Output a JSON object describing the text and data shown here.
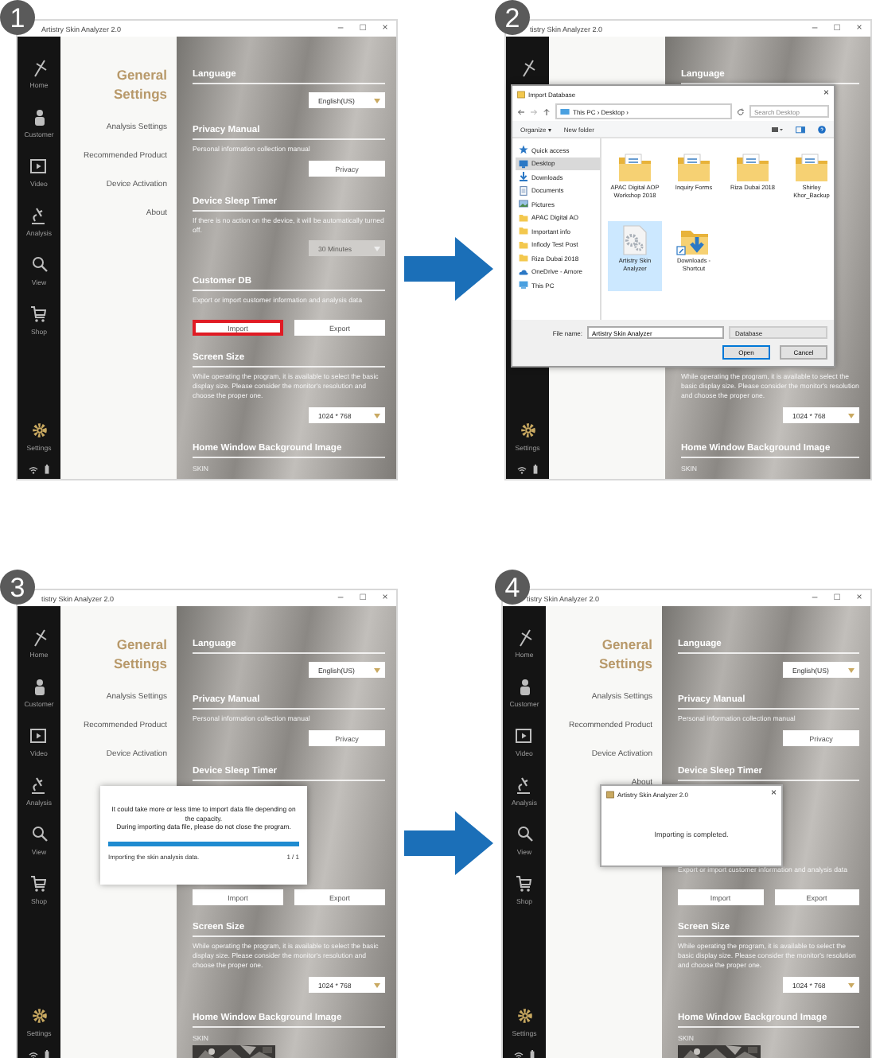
{
  "steps": [
    {
      "number": "1",
      "window": {
        "title": "Artistry Skin Analyzer 2.0",
        "controls": [
          "–",
          "□",
          "×"
        ],
        "nav": [
          {
            "kind": "home",
            "label": "Home"
          },
          {
            "kind": "customer",
            "label": "Customer"
          },
          {
            "kind": "video",
            "label": "Video"
          },
          {
            "kind": "analysis",
            "label": "Analysis"
          },
          {
            "kind": "view",
            "label": "View"
          },
          {
            "kind": "shop",
            "label": "Shop"
          },
          {
            "kind": "settings",
            "label": "Settings"
          }
        ],
        "menu": {
          "title": "General Settings",
          "items": [
            "Analysis Settings",
            "Recommended Product",
            "Device Activation",
            "About"
          ]
        },
        "sections": [
          {
            "kind": "language",
            "heading": "Language",
            "dropdown": {
              "value": "English(US)",
              "disabled": false
            }
          },
          {
            "kind": "privacy",
            "heading": "Privacy Manual",
            "description": "Personal information collection manual",
            "buttons": [
              {
                "label": "Privacy",
                "highlighted": false
              }
            ]
          },
          {
            "kind": "sleep",
            "heading": "Device Sleep Timer",
            "description": "If there is no action on the device, it will be automatically turned off.",
            "dropdown": {
              "value": "30 Minutes",
              "disabled": true
            }
          },
          {
            "kind": "customer_db",
            "heading": "Customer DB",
            "description": "Export or import customer information and analysis data",
            "buttons": [
              {
                "label": "Import",
                "highlighted": true
              },
              {
                "label": "Export",
                "highlighted": false
              }
            ]
          },
          {
            "kind": "screen_size",
            "heading": "Screen Size",
            "description": "While operating the program, it is available to select the basic display size. Please consider the monitor's resolution and choose the proper one.",
            "dropdown": {
              "value": "1024 * 768",
              "disabled": false
            }
          },
          {
            "kind": "background",
            "heading": "Home Window Background Image",
            "caption": "SKIN"
          }
        ]
      }
    },
    {
      "number": "2",
      "window": {
        "title": "tistry Skin Analyzer 2.0",
        "controls": [
          "–",
          "□",
          "×"
        ],
        "nav": [
          {
            "kind": "home"
          },
          {
            "kind": "settings",
            "label": "Settings"
          }
        ],
        "sections": [
          {
            "kind": "language",
            "heading": "Language"
          },
          {
            "kind": "screen_size",
            "description": "While operating the program, it is available to select the basic display size. Please consider the monitor's resolution and choose the proper one.",
            "dropdown": {
              "value": "1024 * 768",
              "disabled": false
            }
          },
          {
            "kind": "background",
            "heading": "Home Window Background Image",
            "caption": "SKIN"
          }
        ]
      },
      "overlay": {
        "kind": "file_dialog",
        "title": "Import Database",
        "close": "×",
        "path": "This PC  ›  Desktop  ›",
        "search": {
          "placeholder": "Search Desktop"
        },
        "toolbar": [
          "Organize ▾",
          "New folder"
        ],
        "tree": [
          {
            "kind": "star",
            "label": "Quick access",
            "selected": false
          },
          {
            "kind": "desktop",
            "label": "Desktop",
            "selected": true
          },
          {
            "kind": "download",
            "label": "Downloads",
            "selected": false
          },
          {
            "kind": "documents",
            "label": "Documents",
            "selected": false
          },
          {
            "kind": "pictures",
            "label": "Pictures",
            "selected": false
          },
          {
            "kind": "folder",
            "label": "APAC Digital AO",
            "selected": false
          },
          {
            "kind": "folder",
            "label": "Important info",
            "selected": false
          },
          {
            "kind": "folder",
            "label": "Infiody Test Post",
            "selected": false
          },
          {
            "kind": "folder",
            "label": "Riza Dubai 2018",
            "selected": false
          },
          {
            "kind": "cloud",
            "label": "OneDrive - Amore",
            "selected": false
          },
          {
            "kind": "pc",
            "label": "This PC",
            "selected": false
          }
        ],
        "files": [
          {
            "kind": "folder",
            "name": "APAC Digital AOP Workshop 2018",
            "selected": false
          },
          {
            "kind": "folder",
            "name": "Inquiry Forms",
            "selected": false
          },
          {
            "kind": "folder",
            "name": "Riza Dubai 2018",
            "selected": false
          },
          {
            "kind": "folder",
            "name": "Shirley Khor_Backup",
            "selected": false
          },
          {
            "kind": "file",
            "name": "Artistry Skin Analyzer",
            "selected": true
          },
          {
            "kind": "shortcut",
            "name": "Downloads - Shortcut",
            "selected": false
          }
        ],
        "file_name_label": "File name:",
        "file_name": "Artistry Skin Analyzer",
        "file_type": "Database",
        "buttons": [
          "Open",
          "Cancel"
        ]
      }
    },
    {
      "number": "3",
      "window": {
        "title": "tistry Skin Analyzer 2.0",
        "controls": [
          "–",
          "□",
          "×"
        ],
        "nav": [
          {
            "kind": "home",
            "label": "Home"
          },
          {
            "kind": "customer",
            "label": "Customer"
          },
          {
            "kind": "video",
            "label": "Video"
          },
          {
            "kind": "analysis",
            "label": "Analysis"
          },
          {
            "kind": "view",
            "label": "View"
          },
          {
            "kind": "shop",
            "label": "Shop"
          },
          {
            "kind": "settings",
            "label": "Settings"
          }
        ],
        "menu": {
          "title": "General Settings",
          "items": [
            "Analysis Settings",
            "Recommended Product",
            "Device Activation"
          ]
        },
        "sections": [
          {
            "kind": "language",
            "heading": "Language",
            "dropdown": {
              "value": "English(US)",
              "disabled": false
            }
          },
          {
            "kind": "privacy",
            "heading": "Privacy Manual",
            "description": "Personal information collection manual",
            "buttons": [
              {
                "label": "Privacy",
                "highlighted": false
              }
            ]
          },
          {
            "kind": "sleep",
            "heading": "Device Sleep Timer"
          },
          {
            "kind": "customer_db",
            "buttons": [
              {
                "label": "Import",
                "highlighted": false
              },
              {
                "label": "Export",
                "highlighted": false
              }
            ]
          },
          {
            "kind": "screen_size",
            "heading": "Screen Size",
            "description": "While operating the program, it is available to select the basic display size. Please consider the monitor's resolution and choose the proper one.",
            "dropdown": {
              "value": "1024 * 768",
              "disabled": false
            }
          },
          {
            "kind": "background",
            "heading": "Home Window Background Image",
            "caption": "SKIN"
          }
        ]
      },
      "overlay": {
        "kind": "progress",
        "lines": [
          "It could take more or less time to import data file depending on the capacity.",
          "During importing data file, please do not close the program."
        ],
        "level": 1,
        "status": "Importing the skin analysis data.",
        "count": "1 / 1"
      }
    },
    {
      "number": "4",
      "window": {
        "title": "tistry Skin Analyzer 2.0",
        "controls": [
          "–",
          "□",
          "×"
        ],
        "nav": [
          {
            "kind": "home",
            "label": "Home"
          },
          {
            "kind": "customer",
            "label": "Customer"
          },
          {
            "kind": "video",
            "label": "Video"
          },
          {
            "kind": "analysis",
            "label": "Analysis"
          },
          {
            "kind": "view",
            "label": "View"
          },
          {
            "kind": "shop",
            "label": "Shop"
          },
          {
            "kind": "settings",
            "label": "Settings"
          }
        ],
        "menu": {
          "title": "General Settings",
          "items": [
            "Analysis Settings",
            "Recommended Product",
            "Device Activation",
            "About"
          ]
        },
        "sections": [
          {
            "kind": "language",
            "heading": "Language",
            "dropdown": {
              "value": "English(US)",
              "disabled": false
            }
          },
          {
            "kind": "privacy",
            "heading": "Privacy Manual",
            "description": "Personal information collection manual",
            "buttons": [
              {
                "label": "Privacy",
                "highlighted": false
              }
            ]
          },
          {
            "kind": "sleep",
            "heading": "Device Sleep Timer"
          },
          {
            "kind": "customer_db",
            "description": "Export or import customer information and analysis data",
            "buttons": [
              {
                "label": "Import",
                "highlighted": false
              },
              {
                "label": "Export",
                "highlighted": false
              }
            ]
          },
          {
            "kind": "screen_size",
            "heading": "Screen Size",
            "description": "While operating the program, it is available to select the basic display size. Please consider the monitor's resolution and choose the proper one.",
            "dropdown": {
              "value": "1024 * 768",
              "disabled": false
            }
          },
          {
            "kind": "background",
            "heading": "Home Window Background Image",
            "caption": "SKIN"
          }
        ]
      },
      "overlay": {
        "kind": "message",
        "title": "Artistry Skin Analyzer 2.0",
        "close": "×",
        "text": "Importing is completed."
      }
    }
  ]
}
